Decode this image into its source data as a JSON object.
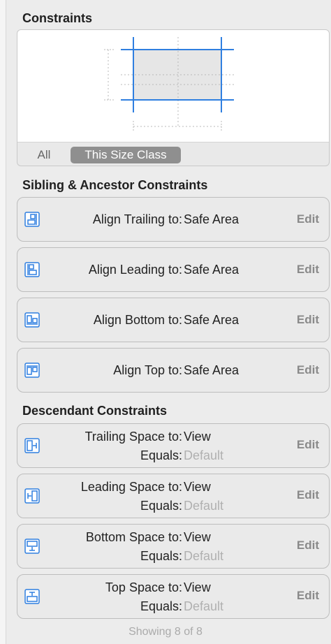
{
  "header": {
    "title": "Constraints"
  },
  "size_class": {
    "tabs": [
      "All",
      "This Size Class"
    ],
    "selected": "This Size Class"
  },
  "sibling_section": {
    "title": "Sibling & Ancestor Constraints",
    "rows": [
      {
        "icon": "align-trailing-icon",
        "label": "Align Trailing to:",
        "value": "Safe Area",
        "edit": "Edit"
      },
      {
        "icon": "align-leading-icon",
        "label": "Align Leading to:",
        "value": "Safe Area",
        "edit": "Edit"
      },
      {
        "icon": "align-bottom-icon",
        "label": "Align Bottom to:",
        "value": "Safe Area",
        "edit": "Edit"
      },
      {
        "icon": "align-top-icon",
        "label": "Align Top to:",
        "value": "Safe Area",
        "edit": "Edit"
      }
    ]
  },
  "descendant_section": {
    "title": "Descendant Constraints",
    "rows": [
      {
        "icon": "trailing-space-icon",
        "label": "Trailing Space to:",
        "value": "View",
        "equals_label": "Equals:",
        "equals_value": "Default",
        "edit": "Edit"
      },
      {
        "icon": "leading-space-icon",
        "label": "Leading Space to:",
        "value": "View",
        "equals_label": "Equals:",
        "equals_value": "Default",
        "edit": "Edit"
      },
      {
        "icon": "bottom-space-icon",
        "label": "Bottom Space to:",
        "value": "View",
        "equals_label": "Equals:",
        "equals_value": "Default",
        "edit": "Edit"
      },
      {
        "icon": "top-space-icon",
        "label": "Top Space to:",
        "value": "View",
        "equals_label": "Equals:",
        "equals_value": "Default",
        "edit": "Edit"
      }
    ]
  },
  "footer": {
    "text": "Showing 8 of 8"
  },
  "colors": {
    "accent": "#2f7fe0",
    "panel_bg": "#ececec",
    "row_border": "#bdbdbd",
    "tab_active": "#8f8f8f"
  }
}
